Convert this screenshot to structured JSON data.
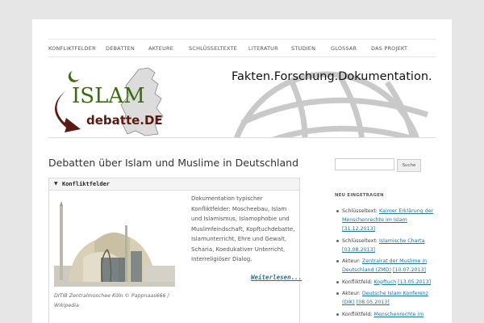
{
  "nav": {
    "items": [
      "KONFLIKTFELDER",
      "DEBATTEN",
      "AKTEURE",
      "SCHLÜSSELTEXTE",
      "LITERATUR",
      "STUDIEN",
      "GLOSSAR",
      "DAS PROJEKT"
    ]
  },
  "banner": {
    "tagline": "Fakten.Forschung.Dokumentation.",
    "logo_top": "ISLAM",
    "logo_bottom": "debatte.DE",
    "colors": {
      "green": "#3a6b12",
      "brown": "#5a1a14",
      "map": "#d8d8d8"
    }
  },
  "content": {
    "title": "Debatten über Islam und Muslime in Deutschland"
  },
  "widget": {
    "title": "Konfliktfelder",
    "description": "Dokumentation typischer Konfliktfelder: Moscheebau, Islam und Islamismus, Islamophobie und Muslimfeindschaft, Kopftuchdebatte, Islamunterricht, Ehre und Gewalt, Scharia, Koedukativer Unterricht, Interreligiöser Dialog.",
    "caption": "DITIB Zentralmoschee Köln © Pappnaas666 / Wikipedia",
    "more_label": "Weiterlesen..."
  },
  "sidebar": {
    "search_button": "Suche",
    "section_title": "NEU EINGETRAGEN",
    "recent": [
      {
        "type": "Schlüsseltext:",
        "link": "Kairoer Erklärung der Menschenrechte im Islam",
        "date": "[31.12.2013]"
      },
      {
        "type": "Schlüsseltext:",
        "link": "Islamische Charta",
        "date": "[03.08.2013]"
      },
      {
        "type": "Akteur:",
        "link": "Zentralrat der Muslime in Deutschland (ZMD)",
        "date": "[10.07.2013]"
      },
      {
        "type": "Konfliktfeld:",
        "link": "Kopftuch",
        "date": "[13.05.2013]"
      },
      {
        "type": "Akteur:",
        "link": "Deutsche Islam Konferenz (DIK)",
        "date": "[08.05.2013]"
      },
      {
        "type": "Konfliktfeld:",
        "link": "Menschenrechte im",
        "date": ""
      }
    ]
  }
}
